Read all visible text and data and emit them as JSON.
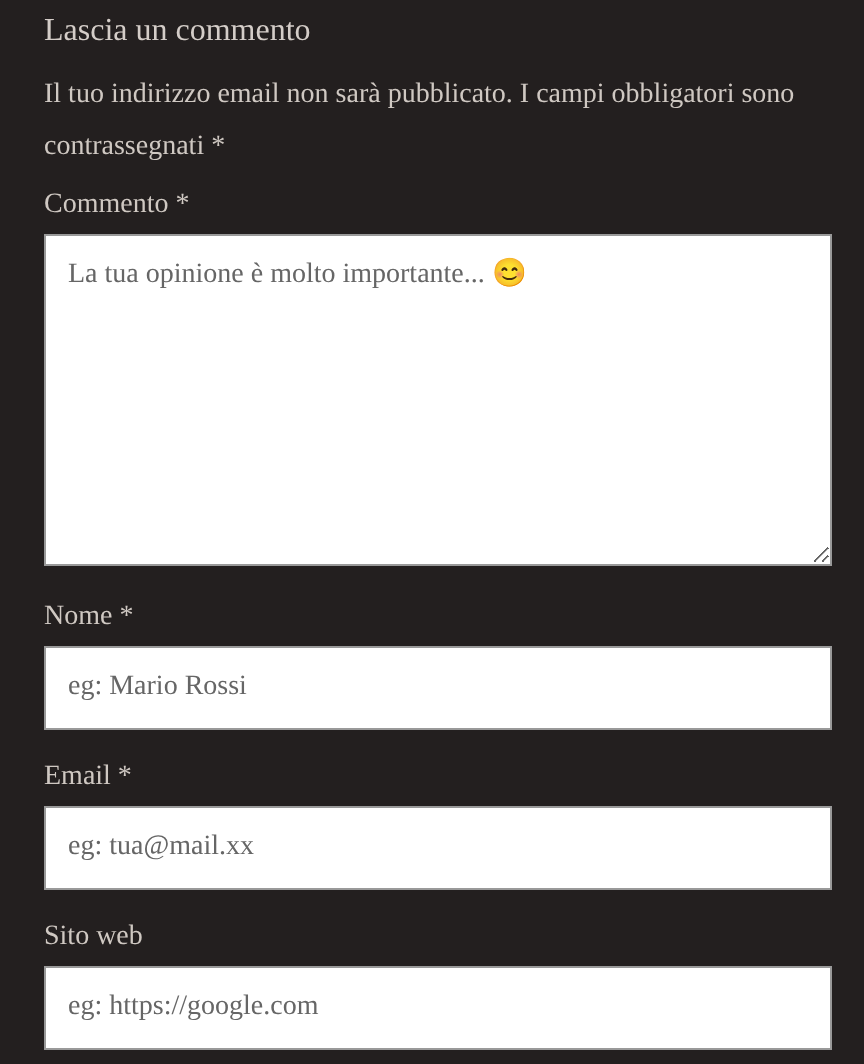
{
  "title": "Lascia un commento",
  "notice": "Il tuo indirizzo email non sarà pubblicato. I campi obbligatori sono contrassegnati *",
  "fields": [
    {
      "kind": "textarea",
      "label": "Commento *",
      "placeholder": "La tua opinione è molto importante... 😊"
    },
    {
      "kind": "input",
      "label": "Nome *",
      "placeholder": "eg: Mario Rossi"
    },
    {
      "kind": "input",
      "label": "Email *",
      "placeholder": "eg: tua@mail.xx"
    },
    {
      "kind": "input",
      "label": "Sito web",
      "placeholder": "eg: https://google.com"
    }
  ]
}
